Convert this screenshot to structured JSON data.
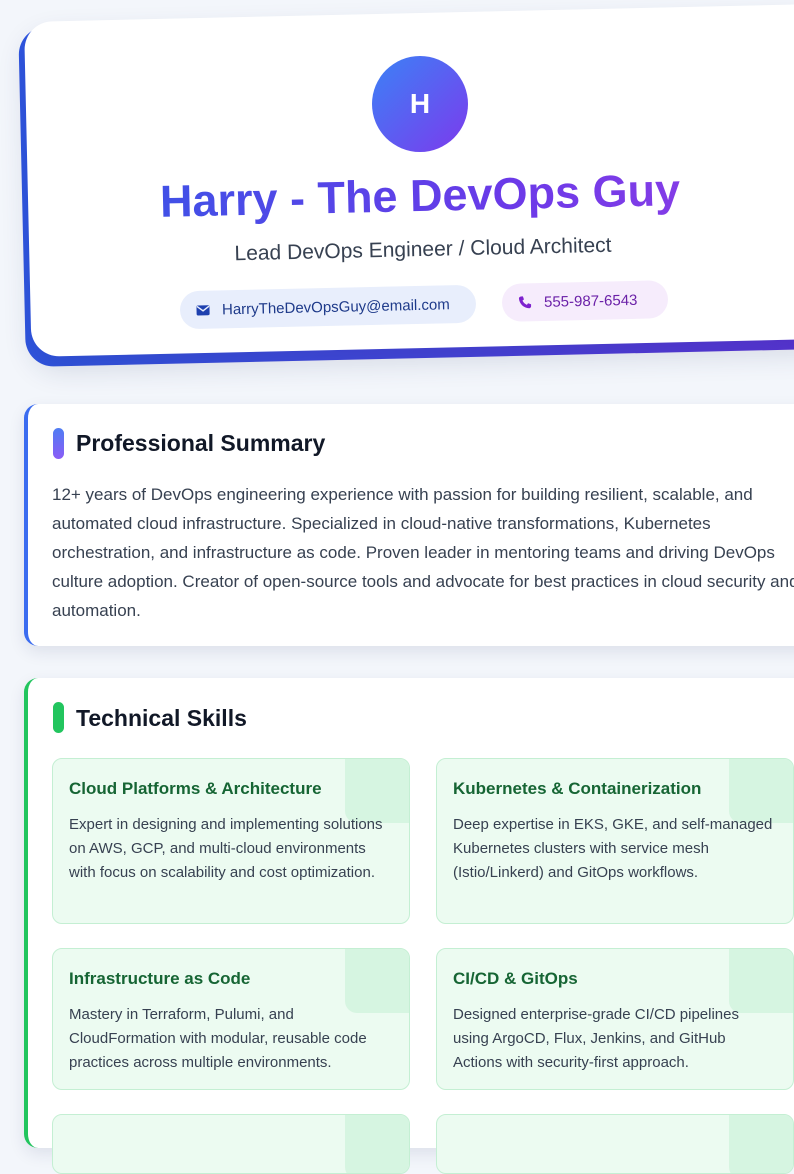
{
  "header": {
    "avatar_initial": "H",
    "name": "Harry - The DevOps Guy",
    "role": "Lead DevOps Engineer / Cloud Architect",
    "email": "HarryTheDevOpsGuy@email.com",
    "phone": "555-987-6543",
    "email_icon": "mail-icon",
    "phone_icon": "phone-icon"
  },
  "summary": {
    "title": "Professional Summary",
    "text": "12+ years of DevOps engineering experience with passion for building resilient, scalable, and automated cloud infrastructure. Specialized in cloud-native transformations, Kubernetes orchestration, and infrastructure as code. Proven leader in mentoring teams and driving DevOps culture adoption. Creator of open-source tools and advocate for best practices in cloud security and automation."
  },
  "skills": {
    "title": "Technical Skills",
    "items": [
      {
        "title": "Cloud Platforms & Architecture",
        "description": "Expert in designing and implementing solutions on AWS, GCP, and multi-cloud environments with focus on scalability and cost optimization."
      },
      {
        "title": "Kubernetes & Containerization",
        "description": "Deep expertise in EKS, GKE, and self-managed Kubernetes clusters with service mesh (Istio/Linkerd) and GitOps workflows."
      },
      {
        "title": "Infrastructure as Code",
        "description": "Mastery in Terraform, Pulumi, and CloudFormation with modular, reusable code practices across multiple environments."
      },
      {
        "title": "CI/CD & GitOps",
        "description": "Designed enterprise-grade CI/CD pipelines using ArgoCD, Flux, Jenkins, and GitHub Actions with security-first approach."
      }
    ]
  },
  "colors": {
    "primary_blue": "#3b6cf0",
    "primary_purple": "#7c3aed",
    "accent_green": "#22c55e",
    "skill_title_green": "#166534"
  }
}
